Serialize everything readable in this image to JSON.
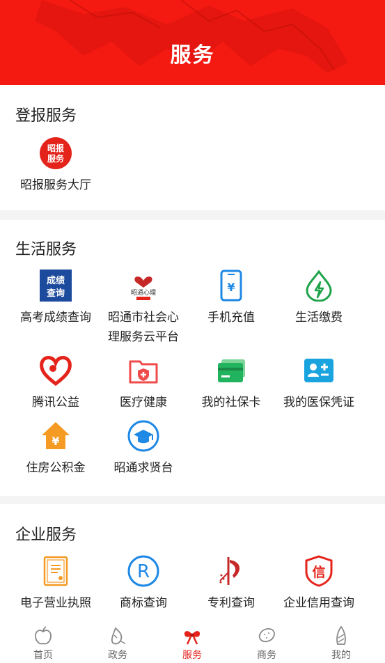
{
  "header": {
    "title": "服务"
  },
  "sections": [
    {
      "title": "登报服务",
      "items": [
        {
          "label": "昭报服务大厅",
          "icon": "zhaobao-logo-icon",
          "icon_text": "昭报服务"
        }
      ]
    },
    {
      "title": "生活服务",
      "items": [
        {
          "label": "高考成绩查询",
          "icon": "score-query-icon",
          "icon_text": "成绩查询"
        },
        {
          "label": "昭通市社会心理服务云平台",
          "label_lines": [
            "昭通市社会心",
            "理服务云平台"
          ],
          "icon": "psych-service-icon",
          "icon_text": "昭通心理"
        },
        {
          "label": "手机充值",
          "icon": "phone-recharge-icon"
        },
        {
          "label": "生活缴费",
          "icon": "utility-payment-icon"
        },
        {
          "label": "腾讯公益",
          "icon": "tencent-charity-icon"
        },
        {
          "label": "医疗健康",
          "icon": "medical-health-icon"
        },
        {
          "label": "我的社保卡",
          "icon": "social-security-card-icon"
        },
        {
          "label": "我的医保凭证",
          "icon": "medical-insurance-icon"
        },
        {
          "label": "住房公积金",
          "icon": "housing-fund-icon",
          "icon_text": "¥"
        },
        {
          "label": "昭通求贤台",
          "icon": "talent-recruit-icon"
        }
      ]
    },
    {
      "title": "企业服务",
      "items": [
        {
          "label": "电子营业执照",
          "icon": "business-license-icon"
        },
        {
          "label": "商标查询",
          "icon": "trademark-icon",
          "icon_text": "R"
        },
        {
          "label": "专利查询",
          "icon": "patent-icon"
        },
        {
          "label": "企业信用查询",
          "icon": "credit-icon",
          "icon_text": "信"
        }
      ]
    }
  ],
  "tabs": [
    {
      "label": "首页",
      "icon": "apple-icon",
      "active": false
    },
    {
      "label": "政务",
      "icon": "ginseng-icon",
      "active": false
    },
    {
      "label": "服务",
      "icon": "bow-icon",
      "active": true
    },
    {
      "label": "商务",
      "icon": "potato-icon",
      "active": false
    },
    {
      "label": "我的",
      "icon": "bamboo-shoot-icon",
      "active": false
    }
  ],
  "colors": {
    "header": "#f41a12",
    "accent": "#e4231b",
    "phone": "#1e88e5",
    "green": "#1fa34a",
    "cyan": "#19a4e0",
    "orange": "#f59a23"
  }
}
